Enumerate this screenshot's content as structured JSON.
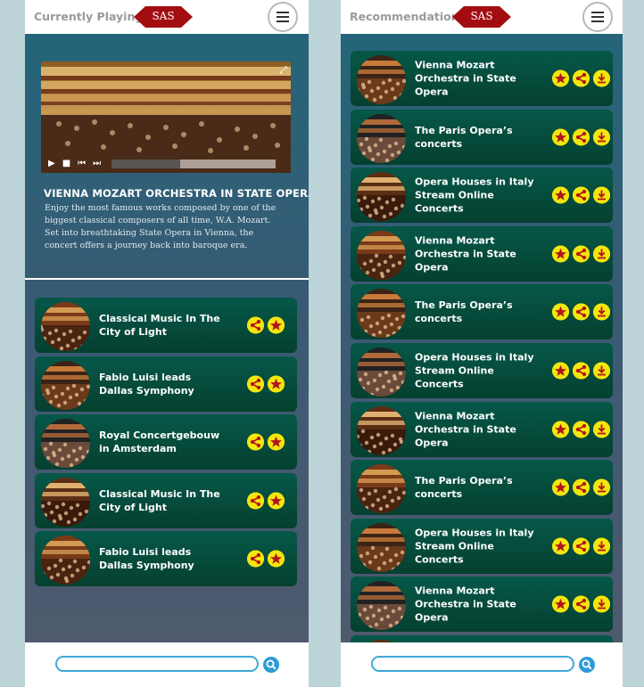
{
  "logo": {
    "text": "SAS"
  },
  "left": {
    "header_title": "Currently Playing",
    "now_playing": {
      "title": "VIENNA MOZART ORCHESTRA IN STATE OPERA",
      "description": "Enjoy the most famous works composed by one of the biggest classical composers of all time, W.A. Mozart. Set into breathtaking State Opera in Vienna, the concert offers a journey back into baroque era.",
      "progress": 0.42
    },
    "items": [
      {
        "title": "Classical Music In The City of Light",
        "icons": [
          "share-icon",
          "star-icon"
        ]
      },
      {
        "title": "Fabio Luisi leads Dallas Symphony",
        "icons": [
          "share-icon",
          "star-icon"
        ]
      },
      {
        "title": "Royal Concertgebouw in Amsterdam",
        "icons": [
          "share-icon",
          "star-icon"
        ]
      },
      {
        "title": "Classical Music In The City of Light",
        "icons": [
          "share-icon",
          "star-icon"
        ]
      },
      {
        "title": "Fabio Luisi leads Dallas Symphony",
        "icons": [
          "share-icon",
          "star-icon"
        ]
      }
    ],
    "search": {
      "value": "",
      "placeholder": ""
    }
  },
  "right": {
    "header_title": "Recommendation",
    "items": [
      {
        "title": "Vienna Mozart Orchestra in State Opera",
        "icons": [
          "star-icon",
          "share-icon",
          "download-icon"
        ]
      },
      {
        "title": "The Paris Opera’s concerts",
        "icons": [
          "star-icon",
          "share-icon",
          "download-icon"
        ]
      },
      {
        "title": "Opera Houses in Italy Stream Online Concerts",
        "icons": [
          "star-icon",
          "share-icon",
          "download-icon"
        ]
      },
      {
        "title": "Vienna Mozart Orchestra in State Opera",
        "icons": [
          "star-icon",
          "share-icon",
          "download-icon"
        ]
      },
      {
        "title": "The Paris Opera’s concerts",
        "icons": [
          "star-icon",
          "share-icon",
          "download-icon"
        ]
      },
      {
        "title": "Opera Houses in Italy Stream Online Concerts",
        "icons": [
          "star-icon",
          "share-icon",
          "download-icon"
        ]
      },
      {
        "title": "Vienna Mozart Orchestra in State Opera",
        "icons": [
          "star-icon",
          "share-icon",
          "download-icon"
        ]
      },
      {
        "title": "The Paris Opera’s concerts",
        "icons": [
          "star-icon",
          "share-icon",
          "download-icon"
        ]
      },
      {
        "title": "Opera Houses in Italy Stream Online Concerts",
        "icons": [
          "star-icon",
          "share-icon",
          "download-icon"
        ]
      },
      {
        "title": "Vienna Mozart Orchestra in State Opera",
        "icons": [
          "star-icon",
          "share-icon",
          "download-icon"
        ]
      },
      {
        "title": "",
        "icons": []
      }
    ],
    "search": {
      "value": "",
      "placeholder": ""
    }
  },
  "colors": {
    "accent_blue": "#3fa8d9",
    "logo_red": "#a30d12",
    "icon_yellow": "#f3e60d",
    "card_green": "#065849"
  }
}
